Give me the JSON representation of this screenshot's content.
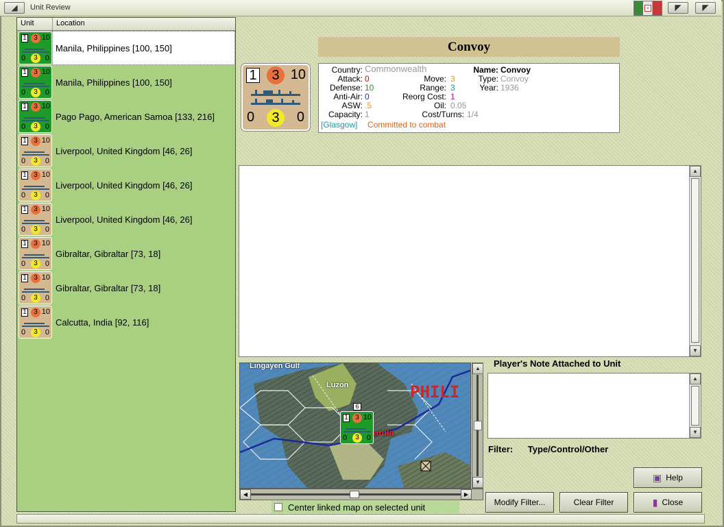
{
  "window": {
    "title": "Unit Review"
  },
  "list": {
    "headers": [
      "Unit",
      "Location"
    ],
    "rows": [
      {
        "color": "green",
        "top": [
          "1",
          "3",
          "10"
        ],
        "bottom": [
          "0",
          "3",
          "0"
        ],
        "location": "Manila, Philippines [100, 150]",
        "selected": true
      },
      {
        "color": "green",
        "top": [
          "1",
          "3",
          "10"
        ],
        "bottom": [
          "0",
          "3",
          "0"
        ],
        "location": "Manila, Philippines [100, 150]",
        "selected": false
      },
      {
        "color": "green",
        "top": [
          "1",
          "3",
          "10"
        ],
        "bottom": [
          "0",
          "3",
          "0"
        ],
        "location": "Pago Pago, American Samoa [133, 216]",
        "selected": false
      },
      {
        "color": "tan",
        "top": [
          "1",
          "3",
          "10"
        ],
        "bottom": [
          "0",
          "3",
          "0"
        ],
        "location": "Liverpool, United Kingdom [46, 26]",
        "selected": false
      },
      {
        "color": "tan",
        "top": [
          "1",
          "3",
          "10"
        ],
        "bottom": [
          "0",
          "3",
          "0"
        ],
        "location": "Liverpool, United Kingdom [46, 26]",
        "selected": false
      },
      {
        "color": "tan",
        "top": [
          "1",
          "3",
          "10"
        ],
        "bottom": [
          "0",
          "3",
          "0"
        ],
        "location": "Liverpool, United Kingdom [46, 26]",
        "selected": false
      },
      {
        "color": "tan",
        "top": [
          "1",
          "3",
          "10"
        ],
        "bottom": [
          "0",
          "3",
          "0"
        ],
        "location": "Gibraltar, Gibraltar [73, 18]",
        "selected": false
      },
      {
        "color": "tan",
        "top": [
          "1",
          "3",
          "10"
        ],
        "bottom": [
          "0",
          "3",
          "0"
        ],
        "location": "Gibraltar, Gibraltar [73, 18]",
        "selected": false
      },
      {
        "color": "tan",
        "top": [
          "1",
          "3",
          "10"
        ],
        "bottom": [
          "0",
          "3",
          "0"
        ],
        "location": "Calcutta, India [92, 116]",
        "selected": false
      }
    ]
  },
  "unit": {
    "name_banner": "Convoy",
    "counter": {
      "box": "1",
      "orange": "3",
      "ten": "10",
      "left": "0",
      "yellow": "3",
      "right": "0"
    },
    "labels": {
      "country": "Country:",
      "attack": "Attack:",
      "defense": "Defense:",
      "anti_air": "Anti-Air:",
      "asw": "ASW:",
      "capacity": "Capacity:",
      "move": "Move:",
      "range": "Range:",
      "reorg": "Reorg Cost:",
      "oil": "Oil:",
      "cost_turns": "Cost/Turns:",
      "name": "Name:",
      "type": "Type:",
      "year": "Year:"
    },
    "values": {
      "country": "Commonwealth",
      "attack": "0",
      "defense": "10",
      "anti_air": "0",
      "asw": ".5",
      "capacity": "1",
      "move": "3",
      "range": "3",
      "reorg": "1",
      "oil": "0.05",
      "cost_turns": "1/4",
      "name": "Convoy",
      "type": "Convoy",
      "year": "1936"
    },
    "status_prefix": "[Glasgow]",
    "status_text": "Committed to combat"
  },
  "map": {
    "labels": {
      "gulf": "Lingayen Gulf",
      "island": "Luzon",
      "country": "PHILI",
      "city": "anila"
    },
    "counter": {
      "box": "1",
      "orange": "3",
      "ten": "10",
      "left": "0",
      "yellow": "3",
      "right": "0",
      "stack": "6"
    }
  },
  "center_checkbox_label": "Center linked map on selected unit",
  "note_title": "Player's Note Attached to Unit",
  "filter": {
    "label": "Filter:",
    "value": "Type/Control/Other"
  },
  "buttons": {
    "help": "Help",
    "modify": "Modify Filter...",
    "clear": "Clear Filter",
    "close": "Close"
  },
  "colors": {
    "green_counter": "#1e9a2a",
    "tan_counter": "#d4b892",
    "list_bg": "#a8d080",
    "banner": "#d1c293"
  }
}
